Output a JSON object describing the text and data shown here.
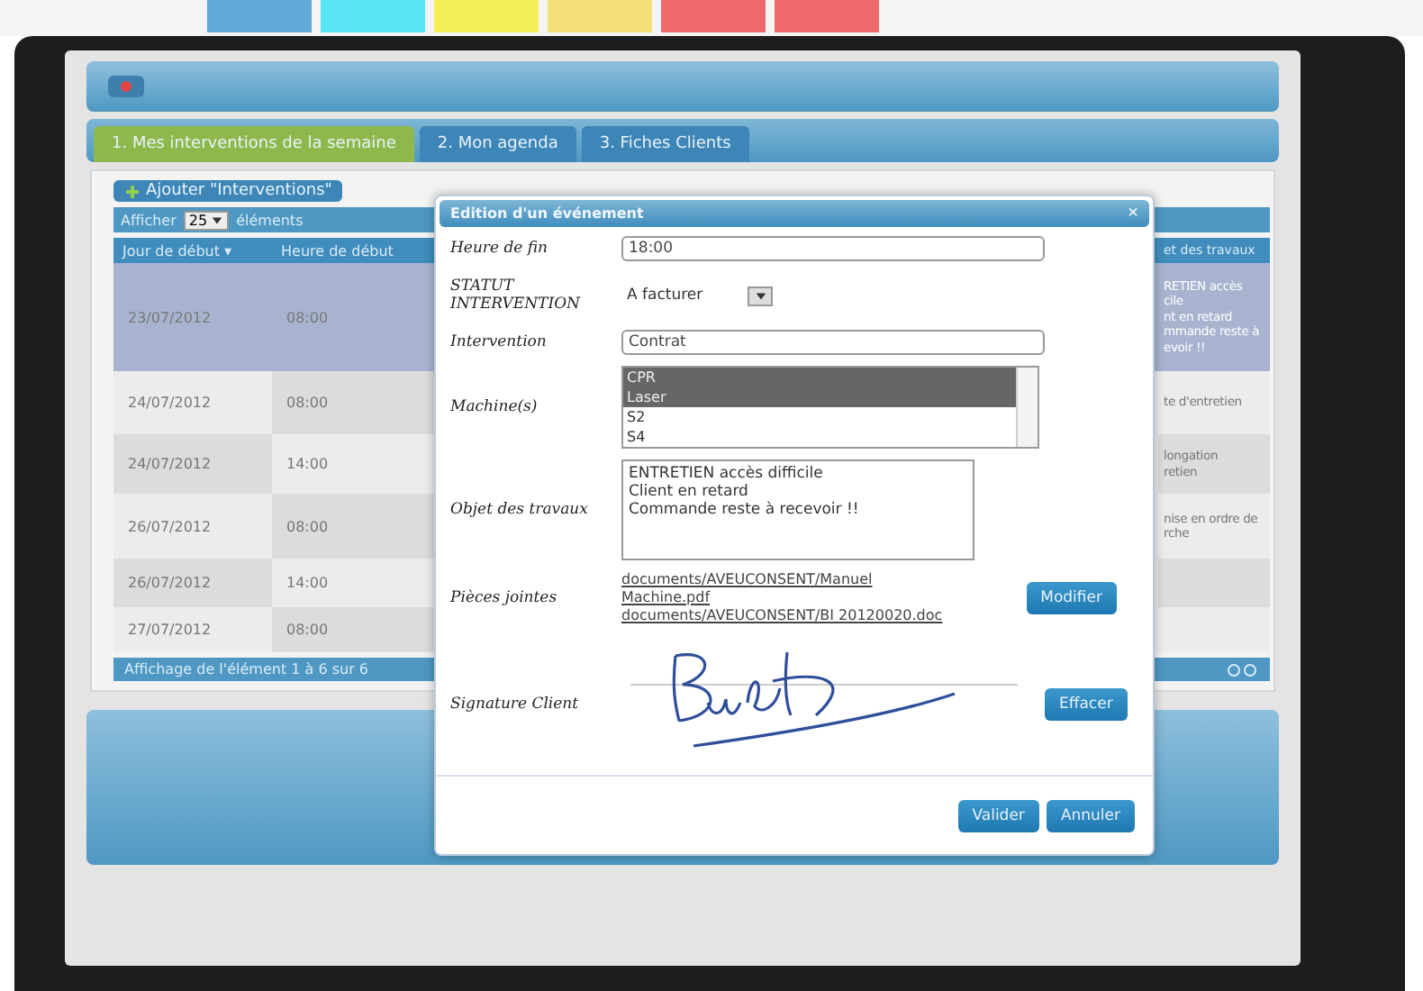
{
  "calendar_strip": [
    {
      "color": "#5fa9d6"
    },
    {
      "color": "#58e6f2"
    },
    {
      "color": "#f4ee58"
    },
    {
      "color": "#f2df79"
    },
    {
      "color": "#ef6a6a"
    },
    {
      "color": "#ef6a6a"
    }
  ],
  "tabs": [
    {
      "label": "1. Mes interventions de la semaine",
      "selected": true
    },
    {
      "label": "2. Mon agenda",
      "selected": false
    },
    {
      "label": "3. Fiches Clients",
      "selected": false
    }
  ],
  "add_button": "Ajouter \"Interventions\"",
  "length_menu": {
    "before": "Afficher",
    "value": "25",
    "after": "éléments"
  },
  "table": {
    "columns": [
      "Jour de début",
      "Heure de début",
      "et des travaux"
    ],
    "sort_icon": "▾",
    "rows": [
      {
        "selected": true,
        "cells": [
          "23/07/2012",
          "08:00"
        ],
        "objet": [
          "RETIEN accès",
          "cile",
          "nt en retard",
          "mmande reste à",
          "evoir !!"
        ]
      },
      {
        "selected": false,
        "cells": [
          "24/07/2012",
          "08:00"
        ],
        "objet": [
          "te d'entretien"
        ]
      },
      {
        "selected": false,
        "cells": [
          "24/07/2012",
          "14:00"
        ],
        "objet": [
          "longation",
          "retien"
        ]
      },
      {
        "selected": false,
        "cells": [
          "26/07/2012",
          "08:00"
        ],
        "objet": [
          "nise en ordre de",
          "rche"
        ]
      },
      {
        "selected": false,
        "cells": [
          "26/07/2012",
          "14:00"
        ],
        "objet": []
      },
      {
        "selected": false,
        "cells": [
          "27/07/2012",
          "08:00"
        ],
        "objet": []
      }
    ],
    "info": "Affichage de l'élément 1 à 6 sur 6"
  },
  "dialog": {
    "title": "Edition d'un événement",
    "close": "×",
    "fields": [
      {
        "kind": "input",
        "label": "Heure de fin",
        "value": "18:00"
      },
      {
        "kind": "select",
        "label": "STATUT INTERVENTION",
        "value": "A facturer"
      },
      {
        "kind": "input",
        "label": "Intervention",
        "value": "Contrat"
      },
      {
        "kind": "multiselect",
        "label": "Machine(s)",
        "options": [
          {
            "label": "CPR",
            "selected": true
          },
          {
            "label": "Laser",
            "selected": true
          },
          {
            "label": "S2",
            "selected": false
          },
          {
            "label": "S4",
            "selected": false
          }
        ]
      },
      {
        "kind": "textarea",
        "label": "Objet des travaux",
        "lines": [
          "ENTRETIEN accès difficile",
          "Client en retard",
          "Commande reste à recevoir !!"
        ]
      },
      {
        "kind": "files",
        "label": "Pièces jointes",
        "links": [
          "documents/AVEUCONSENT/Manuel Machine.pdf",
          "documents/AVEUCONSENT/BI 20120020.doc"
        ],
        "button": "Modifier"
      },
      {
        "kind": "signature",
        "label": "Signature Client",
        "button": "Effacer"
      }
    ],
    "buttons": [
      "Valider",
      "Annuler"
    ]
  }
}
